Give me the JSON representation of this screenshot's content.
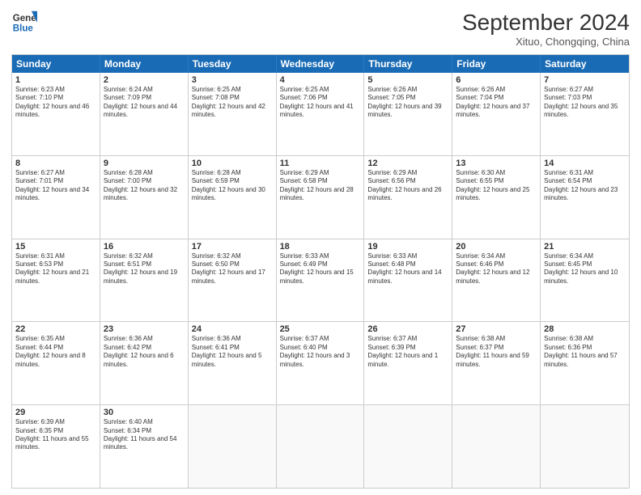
{
  "header": {
    "logo_line1": "General",
    "logo_line2": "Blue",
    "month_title": "September 2024",
    "location": "Xituo, Chongqing, China"
  },
  "weekdays": [
    "Sunday",
    "Monday",
    "Tuesday",
    "Wednesday",
    "Thursday",
    "Friday",
    "Saturday"
  ],
  "rows": [
    [
      {
        "day": "",
        "empty": true
      },
      {
        "day": "",
        "empty": true
      },
      {
        "day": "",
        "empty": true
      },
      {
        "day": "",
        "empty": true
      },
      {
        "day": "",
        "empty": true
      },
      {
        "day": "",
        "empty": true
      },
      {
        "day": "",
        "empty": true
      }
    ],
    [
      {
        "day": "1",
        "text": "Sunrise: 6:23 AM\nSunset: 7:10 PM\nDaylight: 12 hours and 46 minutes."
      },
      {
        "day": "2",
        "text": "Sunrise: 6:24 AM\nSunset: 7:09 PM\nDaylight: 12 hours and 44 minutes."
      },
      {
        "day": "3",
        "text": "Sunrise: 6:25 AM\nSunset: 7:08 PM\nDaylight: 12 hours and 42 minutes."
      },
      {
        "day": "4",
        "text": "Sunrise: 6:25 AM\nSunset: 7:06 PM\nDaylight: 12 hours and 41 minutes."
      },
      {
        "day": "5",
        "text": "Sunrise: 6:26 AM\nSunset: 7:05 PM\nDaylight: 12 hours and 39 minutes."
      },
      {
        "day": "6",
        "text": "Sunrise: 6:26 AM\nSunset: 7:04 PM\nDaylight: 12 hours and 37 minutes."
      },
      {
        "day": "7",
        "text": "Sunrise: 6:27 AM\nSunset: 7:03 PM\nDaylight: 12 hours and 35 minutes."
      }
    ],
    [
      {
        "day": "8",
        "text": "Sunrise: 6:27 AM\nSunset: 7:01 PM\nDaylight: 12 hours and 34 minutes."
      },
      {
        "day": "9",
        "text": "Sunrise: 6:28 AM\nSunset: 7:00 PM\nDaylight: 12 hours and 32 minutes."
      },
      {
        "day": "10",
        "text": "Sunrise: 6:28 AM\nSunset: 6:59 PM\nDaylight: 12 hours and 30 minutes."
      },
      {
        "day": "11",
        "text": "Sunrise: 6:29 AM\nSunset: 6:58 PM\nDaylight: 12 hours and 28 minutes."
      },
      {
        "day": "12",
        "text": "Sunrise: 6:29 AM\nSunset: 6:56 PM\nDaylight: 12 hours and 26 minutes."
      },
      {
        "day": "13",
        "text": "Sunrise: 6:30 AM\nSunset: 6:55 PM\nDaylight: 12 hours and 25 minutes."
      },
      {
        "day": "14",
        "text": "Sunrise: 6:31 AM\nSunset: 6:54 PM\nDaylight: 12 hours and 23 minutes."
      }
    ],
    [
      {
        "day": "15",
        "text": "Sunrise: 6:31 AM\nSunset: 6:53 PM\nDaylight: 12 hours and 21 minutes."
      },
      {
        "day": "16",
        "text": "Sunrise: 6:32 AM\nSunset: 6:51 PM\nDaylight: 12 hours and 19 minutes."
      },
      {
        "day": "17",
        "text": "Sunrise: 6:32 AM\nSunset: 6:50 PM\nDaylight: 12 hours and 17 minutes."
      },
      {
        "day": "18",
        "text": "Sunrise: 6:33 AM\nSunset: 6:49 PM\nDaylight: 12 hours and 15 minutes."
      },
      {
        "day": "19",
        "text": "Sunrise: 6:33 AM\nSunset: 6:48 PM\nDaylight: 12 hours and 14 minutes."
      },
      {
        "day": "20",
        "text": "Sunrise: 6:34 AM\nSunset: 6:46 PM\nDaylight: 12 hours and 12 minutes."
      },
      {
        "day": "21",
        "text": "Sunrise: 6:34 AM\nSunset: 6:45 PM\nDaylight: 12 hours and 10 minutes."
      }
    ],
    [
      {
        "day": "22",
        "text": "Sunrise: 6:35 AM\nSunset: 6:44 PM\nDaylight: 12 hours and 8 minutes."
      },
      {
        "day": "23",
        "text": "Sunrise: 6:36 AM\nSunset: 6:42 PM\nDaylight: 12 hours and 6 minutes."
      },
      {
        "day": "24",
        "text": "Sunrise: 6:36 AM\nSunset: 6:41 PM\nDaylight: 12 hours and 5 minutes."
      },
      {
        "day": "25",
        "text": "Sunrise: 6:37 AM\nSunset: 6:40 PM\nDaylight: 12 hours and 3 minutes."
      },
      {
        "day": "26",
        "text": "Sunrise: 6:37 AM\nSunset: 6:39 PM\nDaylight: 12 hours and 1 minute."
      },
      {
        "day": "27",
        "text": "Sunrise: 6:38 AM\nSunset: 6:37 PM\nDaylight: 11 hours and 59 minutes."
      },
      {
        "day": "28",
        "text": "Sunrise: 6:38 AM\nSunset: 6:36 PM\nDaylight: 11 hours and 57 minutes."
      }
    ],
    [
      {
        "day": "29",
        "text": "Sunrise: 6:39 AM\nSunset: 6:35 PM\nDaylight: 11 hours and 55 minutes."
      },
      {
        "day": "30",
        "text": "Sunrise: 6:40 AM\nSunset: 6:34 PM\nDaylight: 11 hours and 54 minutes."
      },
      {
        "day": "",
        "empty": true
      },
      {
        "day": "",
        "empty": true
      },
      {
        "day": "",
        "empty": true
      },
      {
        "day": "",
        "empty": true
      },
      {
        "day": "",
        "empty": true
      }
    ]
  ]
}
